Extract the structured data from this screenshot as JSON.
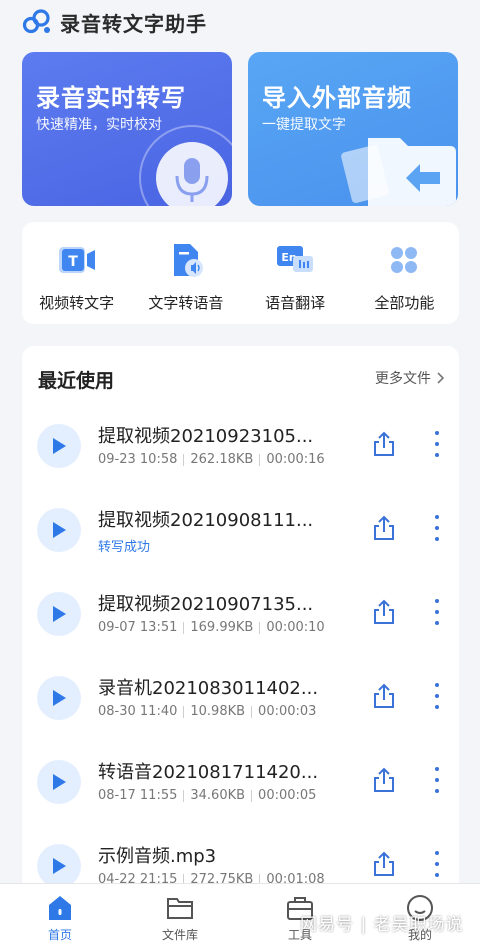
{
  "app": {
    "title": "录音转文字助手"
  },
  "hero": {
    "record": {
      "title": "录音实时转写",
      "subtitle": "快速精准，实时校对"
    },
    "import": {
      "title": "导入外部音频",
      "subtitle": "一键提取文字"
    }
  },
  "quick_actions": [
    {
      "label": "视频转文字",
      "icon": "video-to-text-icon"
    },
    {
      "label": "文字转语音",
      "icon": "text-to-speech-icon"
    },
    {
      "label": "语音翻译",
      "icon": "voice-translate-icon"
    },
    {
      "label": "全部功能",
      "icon": "all-features-icon"
    }
  ],
  "recent": {
    "title": "最近使用",
    "more_label": "更多文件",
    "files": [
      {
        "name": "提取视频20210923105...",
        "date": "09-23 10:58",
        "size": "262.18KB",
        "duration": "00:00:16"
      },
      {
        "name": "提取视频20210908111...",
        "status": "转写成功"
      },
      {
        "name": "提取视频20210907135...",
        "date": "09-07 13:51",
        "size": "169.99KB",
        "duration": "00:00:10"
      },
      {
        "name": "录音机2021083011402...",
        "date": "08-30 11:40",
        "size": "10.98KB",
        "duration": "00:00:03"
      },
      {
        "name": "转语音2021081711420...",
        "date": "08-17 11:55",
        "size": "34.60KB",
        "duration": "00:00:05"
      },
      {
        "name": "示例音频.mp3",
        "date": "04-22 21:15",
        "size": "272.75KB",
        "duration": "00:01:08"
      }
    ]
  },
  "nav": [
    {
      "label": "首页",
      "active": true
    },
    {
      "label": "文件库",
      "active": false
    },
    {
      "label": "工具",
      "active": false
    },
    {
      "label": "我的",
      "active": false
    }
  ],
  "watermark": "网易号 | 老吴职场说",
  "colors": {
    "accent": "#2f78e8",
    "record_card": "#4a64e2",
    "import_card": "#4a92ee"
  }
}
